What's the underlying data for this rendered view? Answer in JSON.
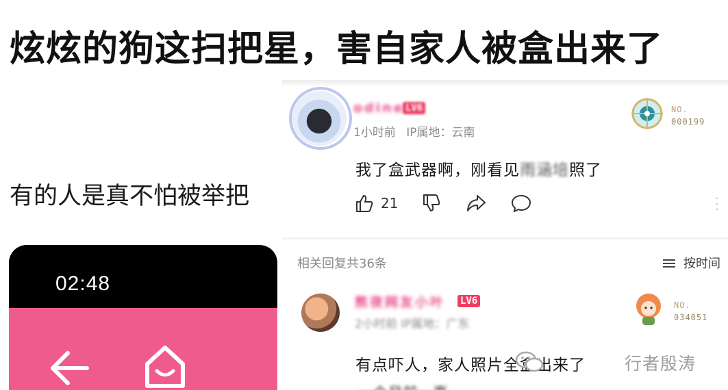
{
  "article": {
    "headline": "炫炫的狗这扫把星，害自家人被盒出来了",
    "excerpt": "有的人是真不怕被举把",
    "phone": {
      "time": "02:48",
      "bar_color": "#f05b8d",
      "back_icon": "arrow-left-icon",
      "home_icon": "home-icon"
    }
  },
  "comment_main": {
    "username": "odine",
    "level": "LV6",
    "time": "1小时前",
    "ip_label": "IP属地：",
    "ip_region": "云南",
    "badge_prefix": "NO.",
    "badge_number": "000199",
    "text_before": "我了盒武器啊，刚看见",
    "text_blurred": "雨涵培",
    "text_after": "照了",
    "likes": "21",
    "icons": [
      "thumbs-up-icon",
      "thumbs-down-icon",
      "share-icon",
      "comment-bubble-icon",
      "more-vertical-icon"
    ]
  },
  "replies": {
    "title": "相关回复共36条",
    "sort_label": "按时间",
    "sort_icon": "list-sort-icon"
  },
  "reply_1": {
    "username": "熬夜网友小叶",
    "level": "LV6",
    "meta": "2小时前 IP属地：广东",
    "badge_prefix": "NO.",
    "badge_number": "034051",
    "text": "有点吓人，家人照片全盒出来了",
    "partial_next_line": "一个月前一直"
  },
  "watermark": {
    "text": "行者殷涛",
    "icon": "wechat-icon"
  },
  "colors": {
    "username_pink": "#ea4b8b",
    "level_red": "#ee3d64",
    "meta_gray": "#8d8d8d"
  }
}
